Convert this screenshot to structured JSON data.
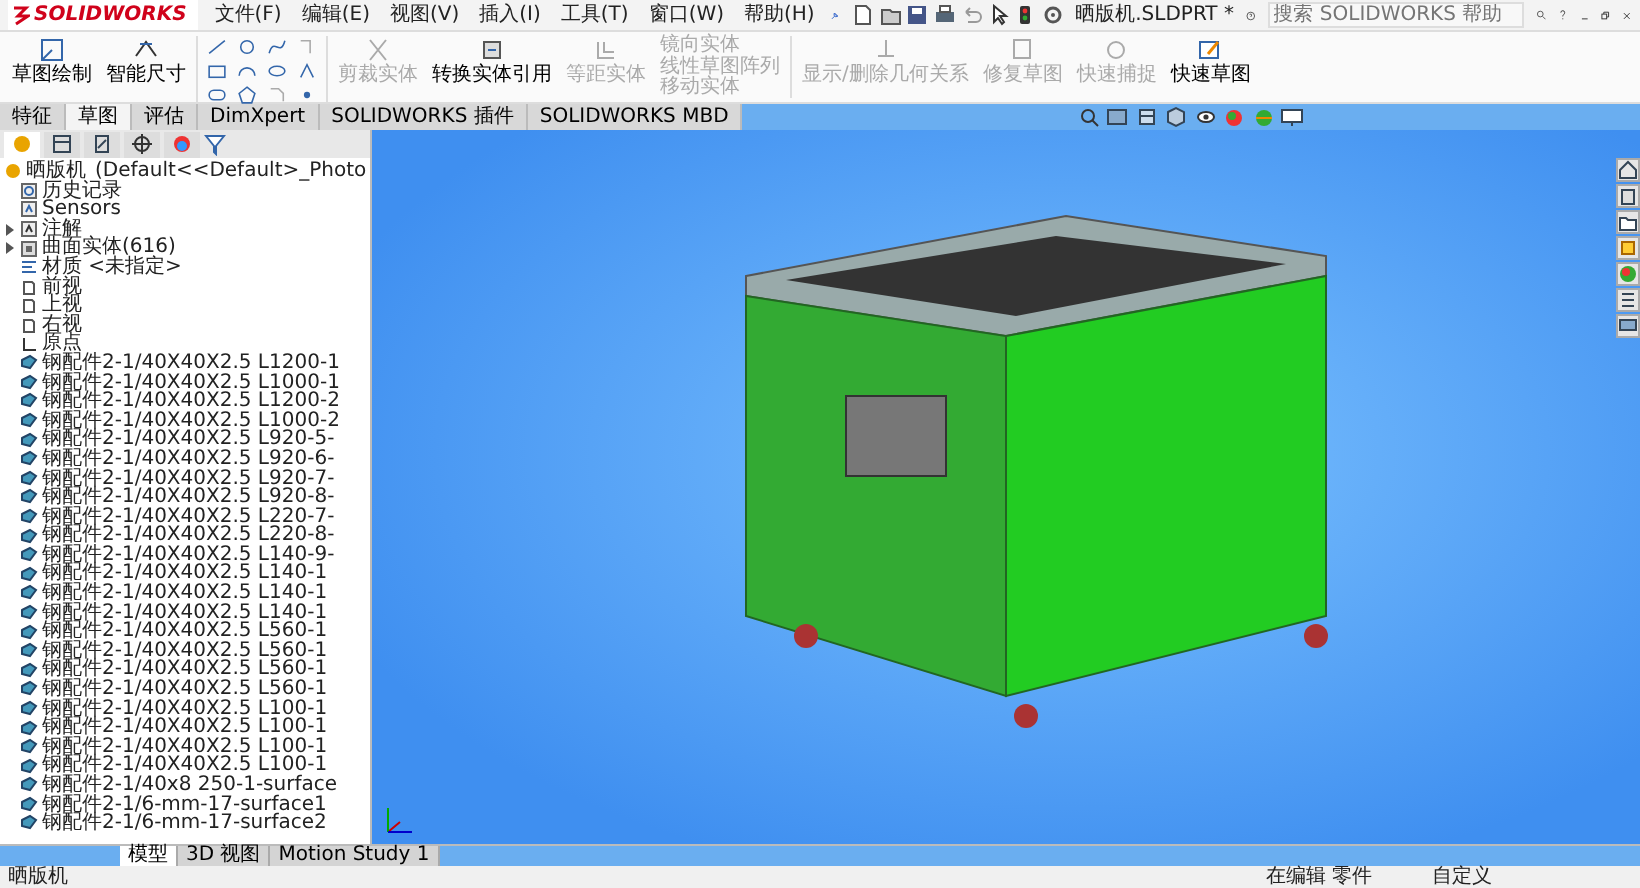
{
  "app": {
    "logo": "SOLIDWORKS",
    "menu": [
      "文件(F)",
      "编辑(E)",
      "视图(V)",
      "插入(I)",
      "工具(T)",
      "窗口(W)",
      "帮助(H)"
    ],
    "title": "晒版机.SLDPRT *",
    "search": {
      "placeholder": "搜索 SOLIDWORKS 帮助"
    }
  },
  "ribbon": [
    {
      "kind": "large",
      "label": "草图绘制",
      "disabled": false
    },
    {
      "kind": "large",
      "label": "智能尺寸",
      "disabled": false
    },
    {
      "kind": "tools"
    },
    {
      "kind": "large",
      "label": "剪裁实体",
      "disabled": true
    },
    {
      "kind": "large",
      "label": "转换实体引用",
      "disabled": false
    },
    {
      "kind": "large",
      "label": "等距实体",
      "disabled": true
    },
    {
      "kind": "list",
      "items": [
        {
          "label": "镜向实体",
          "disabled": true
        },
        {
          "label": "线性草图阵列",
          "disabled": true
        },
        {
          "label": "移动实体",
          "disabled": true
        }
      ]
    },
    {
      "kind": "large",
      "label": "显示/删除几何关系",
      "disabled": true
    },
    {
      "kind": "large",
      "label": "修复草图",
      "disabled": true
    },
    {
      "kind": "large",
      "label": "快速捕捉",
      "disabled": true
    },
    {
      "kind": "large",
      "label": "快速草图",
      "disabled": false
    }
  ],
  "command_tabs": [
    {
      "label": "特征",
      "selected": false
    },
    {
      "label": "草图",
      "selected": true
    },
    {
      "label": "评估",
      "selected": false
    },
    {
      "label": "DimXpert",
      "selected": false
    },
    {
      "label": "SOLIDWORKS 插件",
      "selected": false
    },
    {
      "label": "SOLIDWORKS MBD",
      "selected": false
    }
  ],
  "panel_tabs": [
    {
      "selected": true
    },
    {
      "selected": false
    },
    {
      "selected": false
    },
    {
      "selected": false
    },
    {
      "selected": false
    }
  ],
  "tree": {
    "label": "晒版机",
    "configuration": "(Default<<Default>_Photo",
    "children": [
      {
        "kind": "history",
        "label": "历史记录"
      },
      {
        "kind": "sensor",
        "label": "Sensors"
      },
      {
        "kind": "annotation",
        "label": "注解",
        "expanded": false
      },
      {
        "kind": "bodies",
        "label": "曲面实体(616)",
        "expanded": false
      },
      {
        "kind": "material",
        "label": "材质 <未指定>"
      },
      {
        "kind": "plane",
        "label": "前视"
      },
      {
        "kind": "plane",
        "label": "上视"
      },
      {
        "kind": "plane",
        "label": "右视"
      },
      {
        "kind": "origin",
        "label": "原点"
      },
      {
        "kind": "weld",
        "label": "钢配件2-1/40X40X2.5  L1200-1"
      },
      {
        "kind": "weld",
        "label": "钢配件2-1/40X40X2.5  L1000-1"
      },
      {
        "kind": "weld",
        "label": "钢配件2-1/40X40X2.5  L1200-2"
      },
      {
        "kind": "weld",
        "label": "钢配件2-1/40X40X2.5  L1000-2"
      },
      {
        "kind": "weld",
        "label": "钢配件2-1/40X40X2.5  L920-5-"
      },
      {
        "kind": "weld",
        "label": "钢配件2-1/40X40X2.5  L920-6-"
      },
      {
        "kind": "weld",
        "label": "钢配件2-1/40X40X2.5  L920-7-"
      },
      {
        "kind": "weld",
        "label": "钢配件2-1/40X40X2.5  L920-8-"
      },
      {
        "kind": "weld",
        "label": "钢配件2-1/40X40X2.5  L220-7-"
      },
      {
        "kind": "weld",
        "label": "钢配件2-1/40X40X2.5  L220-8-"
      },
      {
        "kind": "weld",
        "label": "钢配件2-1/40X40X2.5  L140-9-"
      },
      {
        "kind": "weld",
        "label": "钢配件2-1/40X40X2.5  L140-1"
      },
      {
        "kind": "weld",
        "label": "钢配件2-1/40X40X2.5  L140-1"
      },
      {
        "kind": "weld",
        "label": "钢配件2-1/40X40X2.5  L140-1"
      },
      {
        "kind": "weld",
        "label": "钢配件2-1/40X40X2.5  L560-1"
      },
      {
        "kind": "weld",
        "label": "钢配件2-1/40X40X2.5  L560-1"
      },
      {
        "kind": "weld",
        "label": "钢配件2-1/40X40X2.5  L560-1"
      },
      {
        "kind": "weld",
        "label": "钢配件2-1/40X40X2.5  L560-1"
      },
      {
        "kind": "weld",
        "label": "钢配件2-1/40X40X2.5  L100-1"
      },
      {
        "kind": "weld",
        "label": "钢配件2-1/40X40X2.5  L100-1"
      },
      {
        "kind": "weld",
        "label": "钢配件2-1/40X40X2.5  L100-1"
      },
      {
        "kind": "weld",
        "label": "钢配件2-1/40X40X2.5  L100-1"
      },
      {
        "kind": "weld",
        "label": "钢配件2-1/40x8  250-1-surface"
      },
      {
        "kind": "weld",
        "label": "钢配件2-1/6-mm-17-surface1"
      },
      {
        "kind": "weld",
        "label": "钢配件2-1/6-mm-17-surface2"
      }
    ]
  },
  "bottom_tabs": [
    {
      "label": "模型",
      "selected": true
    },
    {
      "label": "3D 视图",
      "selected": false
    },
    {
      "label": "Motion Study 1",
      "selected": false
    }
  ],
  "status_bar": {
    "document": "晒版机",
    "mode": "在编辑 零件",
    "units": "自定义"
  }
}
